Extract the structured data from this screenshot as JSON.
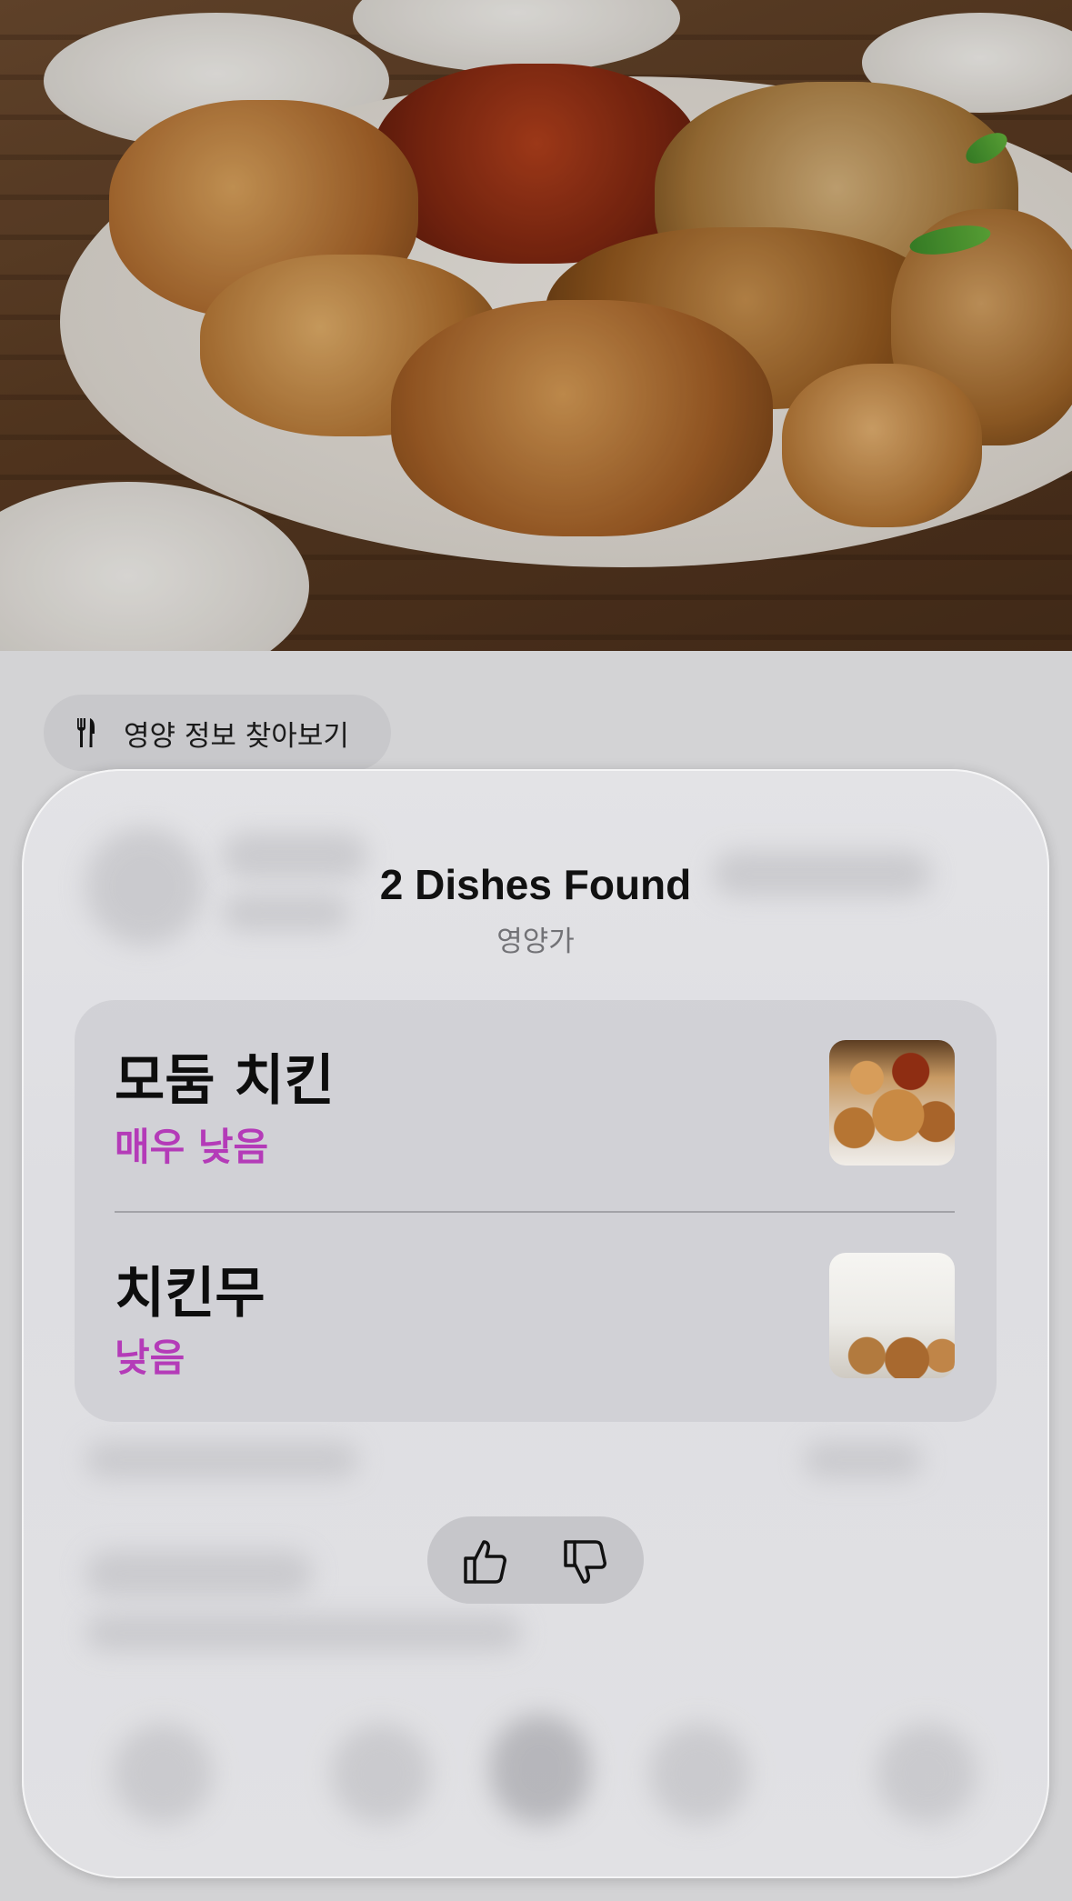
{
  "lookup_chip": {
    "icon": "fork-knife-icon",
    "label": "영양 정보 찾아보기"
  },
  "result_card": {
    "title": "2 Dishes Found",
    "subtitle": "영양가",
    "dishes": [
      {
        "name": "모둠 치킨",
        "rating": "매우 낮음",
        "thumbnail": "fried-chicken-thumbnail"
      },
      {
        "name": "치킨무",
        "rating": "낮음",
        "thumbnail": "pickled-radish-thumbnail"
      }
    ],
    "rating_color": "#b43bb8"
  },
  "feedback": {
    "like_icon": "thumbs-up-icon",
    "dislike_icon": "thumbs-down-icon"
  }
}
